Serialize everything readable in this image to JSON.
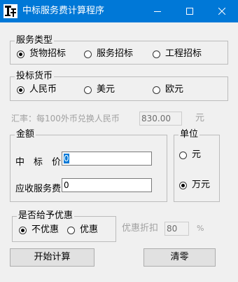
{
  "window": {
    "title": "中标服务费计算程序",
    "minimize_icon": "minimize-icon",
    "maximize_icon": "maximize-icon",
    "close_icon": "close-icon",
    "title_bar_color": "#0078d7"
  },
  "service_type": {
    "legend": "服务类型",
    "options": [
      {
        "label": "货物招标",
        "selected": true
      },
      {
        "label": "服务招标",
        "selected": false
      },
      {
        "label": "工程招标",
        "selected": false
      }
    ]
  },
  "currency": {
    "legend": "投标货币",
    "options": [
      {
        "label": "人民币",
        "selected": true
      },
      {
        "label": "美元",
        "selected": false
      },
      {
        "label": "欧元",
        "selected": false
      }
    ]
  },
  "exchange": {
    "label": "汇率：每100外币兑换人民币",
    "value": "830.00",
    "unit": "元"
  },
  "amount": {
    "legend": "金额",
    "bid_price_label": "中　标　价",
    "bid_price_value": "0",
    "fee_label": "应收服务费",
    "fee_value": "0"
  },
  "unit": {
    "legend": "单位",
    "options": [
      {
        "label": "元",
        "selected": false
      },
      {
        "label": "万元",
        "selected": true
      }
    ]
  },
  "discount": {
    "legend": "是否给予优惠",
    "options": [
      {
        "label": "不优惠",
        "selected": true
      },
      {
        "label": "优惠",
        "selected": false
      }
    ],
    "rate_label": "优惠折扣",
    "rate_value": "80",
    "rate_unit": "%"
  },
  "buttons": {
    "calculate": "开始计算",
    "clear": "清零"
  }
}
